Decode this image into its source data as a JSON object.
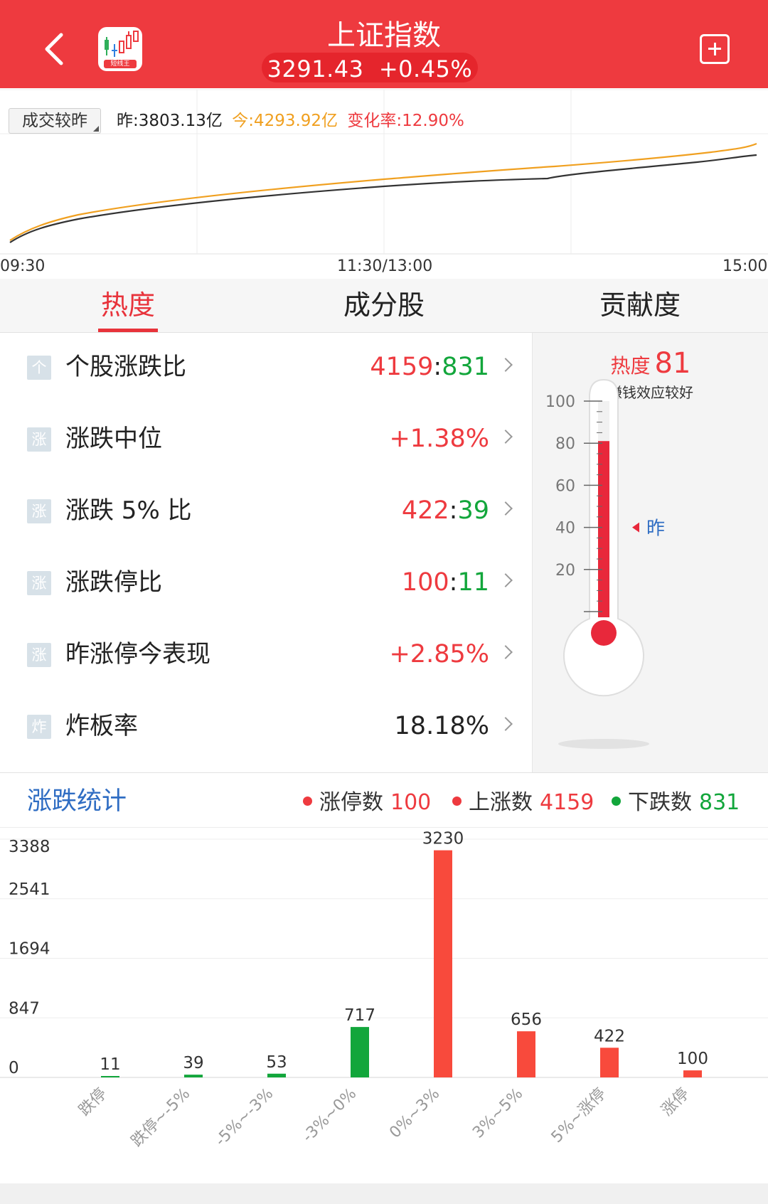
{
  "header": {
    "title": "上证指数",
    "price": "3291.43",
    "change": "+0.45%",
    "app_logo_text": "短线王"
  },
  "volume_compare": {
    "tag_label": "成交较昨",
    "yesterday": "昨:3803.13亿",
    "today": "今:4293.92亿",
    "change_rate": "变化率:12.90%",
    "time_labels": [
      "09:30",
      "11:30/13:00",
      "15:00"
    ],
    "series_colors": {
      "today": "#f0a020",
      "yesterday": "#333333"
    }
  },
  "tabs": [
    {
      "label": "热度",
      "active": true
    },
    {
      "label": "成分股",
      "active": false
    },
    {
      "label": "贡献度",
      "active": false
    }
  ],
  "metrics": [
    {
      "icon": "个",
      "label": "个股涨跌比",
      "up": "4159",
      "sep": ":",
      "down": "831"
    },
    {
      "icon": "涨",
      "label": "涨跌中位",
      "value": "+1.38%",
      "tone": "red"
    },
    {
      "icon": "涨",
      "label": "涨跌 5% 比",
      "up": "422",
      "sep": ":",
      "down": "39"
    },
    {
      "icon": "涨",
      "label": "涨跌停比",
      "up": "100",
      "sep": ":",
      "down": "11"
    },
    {
      "icon": "涨",
      "label": "昨涨停今表现",
      "value": "+2.85%",
      "tone": "red"
    },
    {
      "icon": "炸",
      "label": "炸板率",
      "value": "18.18%",
      "tone": "dark"
    }
  ],
  "thermometer": {
    "label": "热度",
    "value": 81,
    "value_text": "81",
    "subtitle": "赚钱效应较好",
    "scale_labels": [
      "100",
      "80",
      "60",
      "40",
      "20"
    ],
    "yesterday_marker_label": "昨",
    "yesterday_level": 40,
    "fill_color": "#e8283b"
  },
  "stats": {
    "title": "涨跌统计",
    "legend": [
      {
        "label": "涨停数",
        "value": "100",
        "color": "#ee3a3f"
      },
      {
        "label": "上涨数",
        "value": "4159",
        "color": "#ee3a3f"
      },
      {
        "label": "下跌数",
        "value": "831",
        "color": "#12a63b"
      }
    ]
  },
  "chart_data": {
    "type": "bar",
    "categories": [
      "跌停",
      "跌停~-5%",
      "-5%~-3%",
      "-3%~0%",
      "0%~3%",
      "3%~5%",
      "5%~涨停",
      "涨停"
    ],
    "values": [
      11,
      39,
      53,
      717,
      3230,
      656,
      422,
      100
    ],
    "colors": [
      "#12a63b",
      "#12a63b",
      "#12a63b",
      "#12a63b",
      "#f84a3c",
      "#f84a3c",
      "#f84a3c",
      "#f84a3c"
    ],
    "y_ticks": [
      "3388",
      "2541",
      "1694",
      "847",
      "0"
    ],
    "ylim": [
      0,
      3388
    ],
    "grid": true
  }
}
